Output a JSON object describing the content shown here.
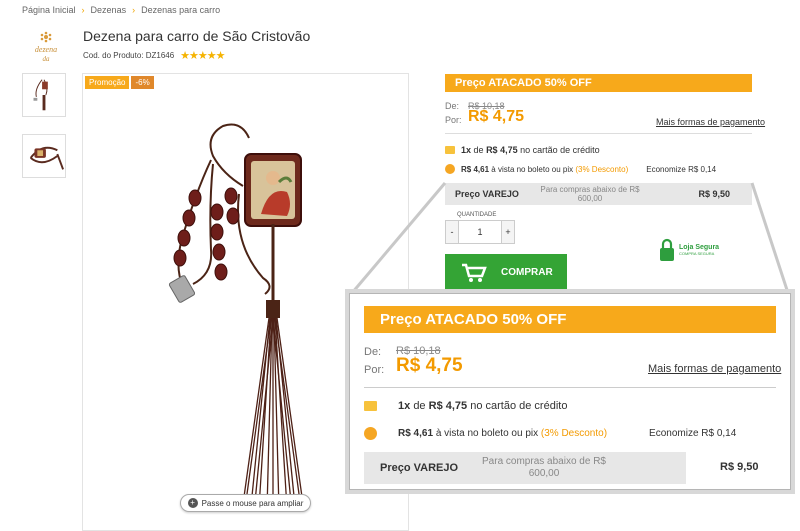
{
  "breadcrumb": [
    "Página Inicial",
    "Dezenas",
    "Dezenas para carro"
  ],
  "logo_alt": "dezena",
  "product": {
    "title": "Dezena para carro de São Cristovão",
    "code_label": "Cod. do Produto: DZ1646",
    "stars": "★★★★★"
  },
  "promo": {
    "label": "Promoção",
    "percent": "-6%"
  },
  "zoom_hint": "Passe o mouse para ampliar",
  "pricing": {
    "banner": "Preço ATACADO 50% OFF",
    "de_label": "De:",
    "old_price": "R$ 10,18",
    "por_label": "Por:",
    "price": "R$ 4,75",
    "more_payments": "Mais formas de pagamento",
    "card_qty": "1x",
    "card_de": "de",
    "card_price": "R$ 4,75",
    "card_text": "no cartão de crédito",
    "boleto_price": "R$ 4,61",
    "boleto_text": "à vista no boleto ou pix",
    "boleto_discount": "(3% Desconto)",
    "economize": "Economize R$ 0,14",
    "varejo_label": "Preço VAREJO",
    "varejo_mid": "Para compras abaixo de R$ 600,00",
    "varejo_price": "R$ 9,50"
  },
  "quantity": {
    "label": "QUANTIDADE",
    "minus": "-",
    "value": "1",
    "plus": "+"
  },
  "buy_button": "COMPRAR",
  "secure": {
    "title": "Loja Segura",
    "subtitle": "COMPRA SEGURA"
  },
  "colors": {
    "accent": "#f7a91b",
    "price": "#f39a00",
    "buy": "#34a435",
    "secure": "#2e9e3e"
  }
}
